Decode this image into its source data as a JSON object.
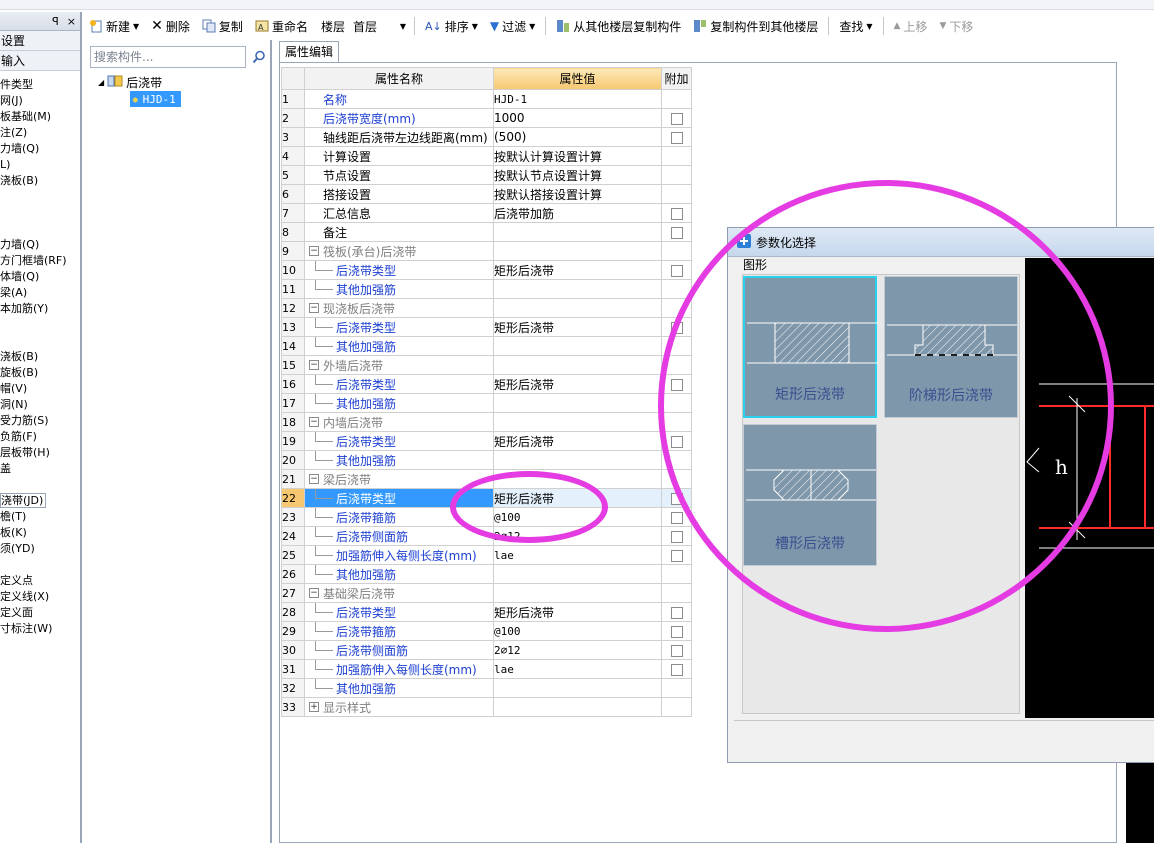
{
  "colors": {
    "accent": "#3399ff",
    "annotation": "#e53be2",
    "shape_tile": "#7e97ab",
    "blue_text": "#1c3fd2",
    "rebar_red": "#ff2020"
  },
  "toolbar": {
    "new_label": "新建",
    "delete_label": "删除",
    "copy_label": "复制",
    "rename_label": "重命名",
    "floor_label": "楼层",
    "floor_value": "首层",
    "sort_label": "排序",
    "filter_label": "过滤",
    "copy_from_label": "从其他楼层复制构件",
    "copy_to_label": "复制构件到其他楼层",
    "find_label": "查找",
    "up_label": "上移",
    "down_label": "下移"
  },
  "leftnav": {
    "header_pin": "ꟼ",
    "header_close": "×",
    "section1": "设置",
    "section2": "输入",
    "items": [
      "件类型",
      "网(J)",
      "板基础(M)",
      "注(Z)",
      "力墙(Q)",
      "L)",
      "浇板(B)",
      "",
      "",
      "",
      "力墙(Q)",
      "方门框墙(RF)",
      "体墙(Q)",
      "梁(A)",
      "本加筋(Y)",
      "",
      "",
      "浇板(B)",
      "旋板(B)",
      "帽(V)",
      "洞(N)",
      "受力筋(S)",
      "负筋(F)",
      "层板带(H)",
      "盖",
      "",
      "浇带(JD)",
      "檐(T)",
      "板(K)",
      "须(YD)",
      "",
      "定义点",
      "定义线(X)",
      "定义面",
      "寸标注(W)"
    ]
  },
  "search": {
    "placeholder": "搜索构件..."
  },
  "tree": {
    "root": "后浇带",
    "child": "HJD-1"
  },
  "props": {
    "tab": "属性编辑",
    "headers": {
      "name": "属性名称",
      "value": "属性值",
      "extra": "附加"
    },
    "rows": [
      {
        "n": "1",
        "name": "名称",
        "value": "HJD-1",
        "level": 0,
        "blue": true,
        "check": false,
        "mono": true
      },
      {
        "n": "2",
        "name": "后浇带宽度(mm)",
        "value": "1000",
        "level": 0,
        "blue": true,
        "check": true
      },
      {
        "n": "3",
        "name": "轴线距后浇带左边线距离(mm)",
        "value": "(500)",
        "level": 0,
        "blue": false,
        "check": true
      },
      {
        "n": "4",
        "name": "计算设置",
        "value": "按默认计算设置计算",
        "level": 0,
        "blue": false,
        "check": false
      },
      {
        "n": "5",
        "name": "节点设置",
        "value": "按默认节点设置计算",
        "level": 0,
        "blue": false,
        "check": false
      },
      {
        "n": "6",
        "name": "搭接设置",
        "value": "按默认搭接设置计算",
        "level": 0,
        "blue": false,
        "check": false
      },
      {
        "n": "7",
        "name": "汇总信息",
        "value": "后浇带加筋",
        "level": 0,
        "blue": false,
        "check": true
      },
      {
        "n": "8",
        "name": "备注",
        "value": "",
        "level": 0,
        "blue": false,
        "check": true
      },
      {
        "n": "9",
        "name": "筏板(承台)后浇带",
        "value": "",
        "level": -1,
        "gray": true
      },
      {
        "n": "10",
        "name": "后浇带类型",
        "value": "矩形后浇带",
        "level": 1,
        "blue": true,
        "check": true
      },
      {
        "n": "11",
        "name": "其他加强筋",
        "value": "",
        "level": 1,
        "blue": true,
        "check": false
      },
      {
        "n": "12",
        "name": "现浇板后浇带",
        "value": "",
        "level": -1,
        "gray": true
      },
      {
        "n": "13",
        "name": "后浇带类型",
        "value": "矩形后浇带",
        "level": 1,
        "blue": true,
        "check": true
      },
      {
        "n": "14",
        "name": "其他加强筋",
        "value": "",
        "level": 1,
        "blue": true,
        "check": false
      },
      {
        "n": "15",
        "name": "外墙后浇带",
        "value": "",
        "level": -1,
        "gray": true
      },
      {
        "n": "16",
        "name": "后浇带类型",
        "value": "矩形后浇带",
        "level": 1,
        "blue": true,
        "check": true
      },
      {
        "n": "17",
        "name": "其他加强筋",
        "value": "",
        "level": 1,
        "blue": true,
        "check": false
      },
      {
        "n": "18",
        "name": "内墙后浇带",
        "value": "",
        "level": -1,
        "gray": true
      },
      {
        "n": "19",
        "name": "后浇带类型",
        "value": "矩形后浇带",
        "level": 1,
        "blue": true,
        "check": true
      },
      {
        "n": "20",
        "name": "其他加强筋",
        "value": "",
        "level": 1,
        "blue": true,
        "check": false
      },
      {
        "n": "21",
        "name": "梁后浇带",
        "value": "",
        "level": -1,
        "gray": true
      },
      {
        "n": "22",
        "name": "后浇带类型",
        "value": "矩形后浇带",
        "level": 1,
        "blue": true,
        "check": true,
        "selected": true
      },
      {
        "n": "23",
        "name": "后浇带箍筋",
        "value": "@100",
        "level": 1,
        "blue": true,
        "check": true,
        "mono": true
      },
      {
        "n": "24",
        "name": "后浇带侧面筋",
        "value": "2⌀12",
        "level": 1,
        "blue": true,
        "check": true,
        "mono": true
      },
      {
        "n": "25",
        "name": "加强筋伸入每侧长度(mm)",
        "value": "lae",
        "level": 1,
        "blue": true,
        "check": true,
        "mono": true
      },
      {
        "n": "26",
        "name": "其他加强筋",
        "value": "",
        "level": 1,
        "blue": true,
        "check": false
      },
      {
        "n": "27",
        "name": "基础梁后浇带",
        "value": "",
        "level": -1,
        "gray": true
      },
      {
        "n": "28",
        "name": "后浇带类型",
        "value": "矩形后浇带",
        "level": 1,
        "blue": true,
        "check": true
      },
      {
        "n": "29",
        "name": "后浇带箍筋",
        "value": "@100",
        "level": 1,
        "blue": true,
        "check": true,
        "mono": true
      },
      {
        "n": "30",
        "name": "后浇带侧面筋",
        "value": "2⌀12",
        "level": 1,
        "blue": true,
        "check": true,
        "mono": true
      },
      {
        "n": "31",
        "name": "加强筋伸入每侧长度(mm)",
        "value": "lae",
        "level": 1,
        "blue": true,
        "check": true,
        "mono": true
      },
      {
        "n": "32",
        "name": "其他加强筋",
        "value": "",
        "level": 1,
        "blue": true,
        "check": false
      },
      {
        "n": "33",
        "name": "显示样式",
        "value": "",
        "level": -2,
        "gray": true
      }
    ]
  },
  "dialog": {
    "title": "参数化选择",
    "group_label": "图形",
    "shapes": [
      {
        "label": "矩形后浇带",
        "active": true
      },
      {
        "label": "阶梯形后浇带",
        "active": false
      },
      {
        "label": "槽形后浇带",
        "active": false
      }
    ],
    "preview_label": "h"
  }
}
